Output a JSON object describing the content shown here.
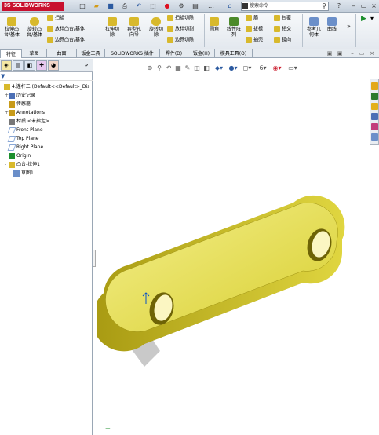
{
  "app": {
    "title": "SOLIDWORKS",
    "logo_prefix": "3S"
  },
  "titlebar": {
    "quick_access": [
      "new-icon",
      "open-icon",
      "save-icon",
      "print-icon",
      "undo-icon",
      "select-icon",
      "rebuild-icon",
      "options-icon",
      "file-props-icon"
    ],
    "search_placeholder": "搜索命令",
    "help_glyph": "?",
    "window_controls": [
      "minimize-icon",
      "restore-icon",
      "close-icon"
    ]
  },
  "ribbon": {
    "big_buttons": [
      {
        "label": "拉伸凸\n台/基体",
        "icon": "extrude-boss-icon"
      },
      {
        "label": "旋转凸\n台/基体",
        "icon": "revolve-boss-icon"
      },
      {
        "label": "拉伸切\n除",
        "icon": "extrude-cut-icon"
      },
      {
        "label": "异型孔\n向导",
        "icon": "hole-wizard-icon"
      },
      {
        "label": "旋转切\n除",
        "icon": "revolve-cut-icon"
      },
      {
        "label": "圆角",
        "icon": "fillet-icon"
      },
      {
        "label": "线性阵\n列",
        "icon": "linear-pattern-icon"
      },
      {
        "label": "参考几\n何体",
        "icon": "reference-geometry-icon"
      },
      {
        "label": "曲线",
        "icon": "curves-icon"
      }
    ],
    "small_buttons": [
      {
        "label": "扫描",
        "icon": "sweep-icon"
      },
      {
        "label": "放样凸台/基体",
        "icon": "loft-icon"
      },
      {
        "label": "边界凸台/基体",
        "icon": "boundary-boss-icon"
      },
      {
        "label": "扫描切除",
        "icon": "swept-cut-icon"
      },
      {
        "label": "放样切割",
        "icon": "lofted-cut-icon"
      },
      {
        "label": "边界切除",
        "icon": "boundary-cut-icon"
      },
      {
        "label": "筋",
        "icon": "rib-icon"
      },
      {
        "label": "拔模",
        "icon": "draft-icon"
      },
      {
        "label": "抽壳",
        "icon": "shell-icon"
      },
      {
        "label": "包覆",
        "icon": "wrap-icon"
      },
      {
        "label": "相交",
        "icon": "intersect-icon"
      },
      {
        "label": "镜向",
        "icon": "mirror-icon"
      }
    ],
    "expand_glyph": "»"
  },
  "tabs": [
    "特征",
    "草图",
    "曲面",
    "钣金工具",
    "SOLIDWORKS 插件",
    "焊件(D)",
    "钣金(H)",
    "模具工具(O)"
  ],
  "active_tab": 0,
  "feature_tree": {
    "tabs": [
      "feature-manager-icon",
      "property-manager-icon",
      "configuration-manager-icon",
      "dimxpert-icon",
      "display-manager-icon"
    ],
    "items": [
      {
        "label": "4.连杆二  (Default<<Default>_Dis",
        "icon": "part-icon",
        "indent": 0,
        "exp": ""
      },
      {
        "label": "历史记录",
        "icon": "history-icon",
        "indent": 1,
        "exp": "+"
      },
      {
        "label": "传感器",
        "icon": "sensors-icon",
        "indent": 1,
        "exp": ""
      },
      {
        "label": "Annotations",
        "icon": "annotations-icon",
        "indent": 1,
        "exp": "+"
      },
      {
        "label": "材质 <未指定>",
        "icon": "material-icon",
        "indent": 1,
        "exp": ""
      },
      {
        "label": "Front Plane",
        "icon": "plane-icon",
        "indent": 1,
        "exp": ""
      },
      {
        "label": "Top Plane",
        "icon": "plane-icon",
        "indent": 1,
        "exp": ""
      },
      {
        "label": "Right Plane",
        "icon": "plane-icon",
        "indent": 1,
        "exp": ""
      },
      {
        "label": "Origin",
        "icon": "origin-icon",
        "indent": 1,
        "exp": ""
      },
      {
        "label": "凸台-拉伸1",
        "icon": "boss-extrude-icon",
        "indent": 1,
        "exp": "-"
      },
      {
        "label": "草图1",
        "icon": "sketch-icon",
        "indent": 2,
        "exp": ""
      }
    ]
  },
  "colors": {
    "accent": "#c8102e",
    "part": "#e2db3a",
    "part_dark": "#8a7d0e",
    "selection": "#0a52c4"
  }
}
